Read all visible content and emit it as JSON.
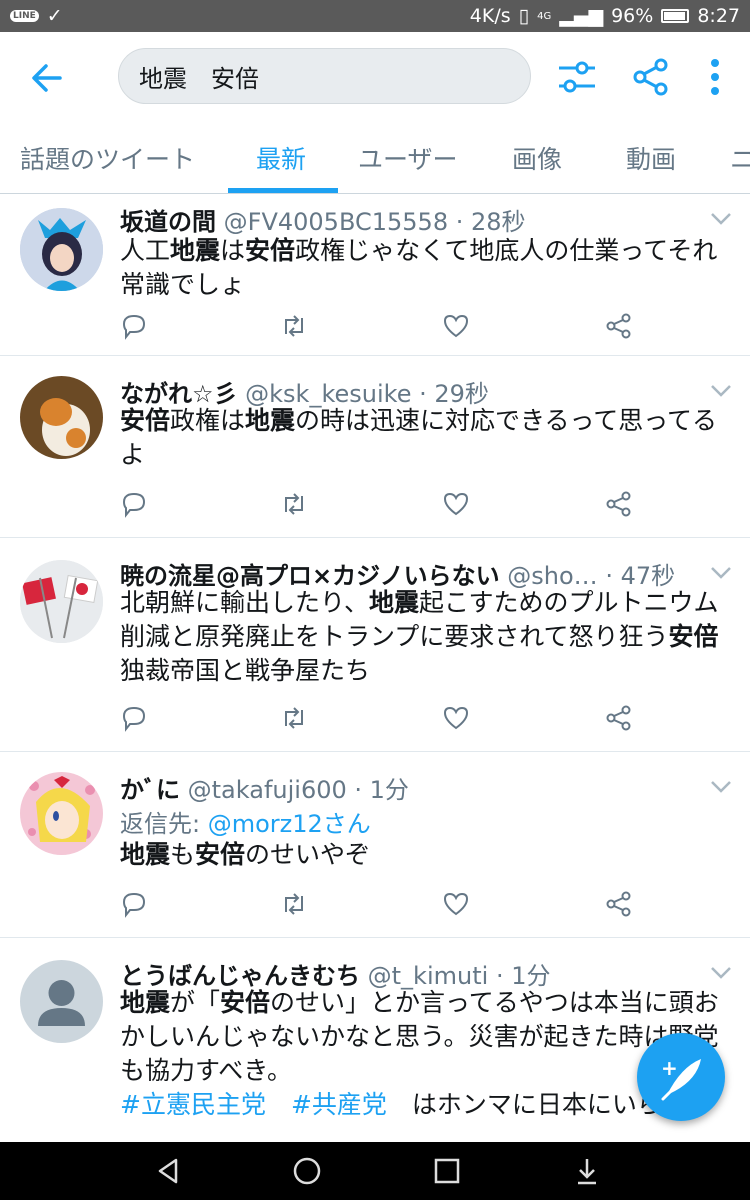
{
  "status": {
    "speed": "4K/s",
    "battery": "96%",
    "time": "8:27",
    "net": "4G",
    "app": "LINE"
  },
  "search": {
    "query": "地震　安倍"
  },
  "tabs": [
    "話題のツイート",
    "最新",
    "ユーザー",
    "画像",
    "動画",
    "ニ"
  ],
  "active_tab": "最新",
  "colors": {
    "accent": "#1da1f2",
    "text": "#14171a",
    "muted": "#657786"
  },
  "tweets": [
    {
      "name": "坂道の間",
      "handle": "@FV4005BC15558",
      "time": "· 28秒",
      "body_html": "人工<b>地震</b>は<b>安倍</b>政権じゃなくて地底人の仕業ってそれ常識でしょ"
    },
    {
      "name": "ながれ☆彡",
      "handle": "@ksk_kesuike",
      "time": "· 29秒",
      "body_html": "<b>安倍</b>政権は<b>地震</b>の時は迅速に対応できるって思ってるよ"
    },
    {
      "name": "暁の流星@高プロ×カジノいらない",
      "handle": "@sho…",
      "time": "· 47秒",
      "body_html": "北朝鮮に輸出したり、<b>地震</b>起こすためのプルトニウム削減と原発廃止をトランプに要求されて怒り狂う<b>安倍</b>独裁帝国と戦争屋たち"
    },
    {
      "name": "かﾞに",
      "handle": "@takafuji600",
      "time": "· 1分",
      "reply_label": "返信先:",
      "reply_target": "@morz12さん",
      "body_html": "<b>地震</b>も<b>安倍</b>のせいやぞ"
    },
    {
      "name": "とうばんじゃんきむち",
      "handle": "@t_kimuti",
      "time": "· 1分",
      "body_html": "<b>地震</b>が「<b>安倍</b>のせい」とか言ってるやつは本当に頭おかしいんじゃないかなと思う。災害が起きた時は野党も協力すべき。<br><span class=\"hashtag\">#立憲民主党</span>　<span class=\"hashtag\">#共産党</span>　はホンマに日本にいらわ"
    }
  ],
  "icons": [
    "back-arrow-icon",
    "filter-icon",
    "share-icon",
    "more-icon",
    "reply-icon",
    "retweet-icon",
    "like-icon",
    "share-tweet-icon",
    "compose-icon",
    "nav-back-icon",
    "nav-home-icon",
    "nav-recent-icon",
    "nav-down-icon"
  ]
}
